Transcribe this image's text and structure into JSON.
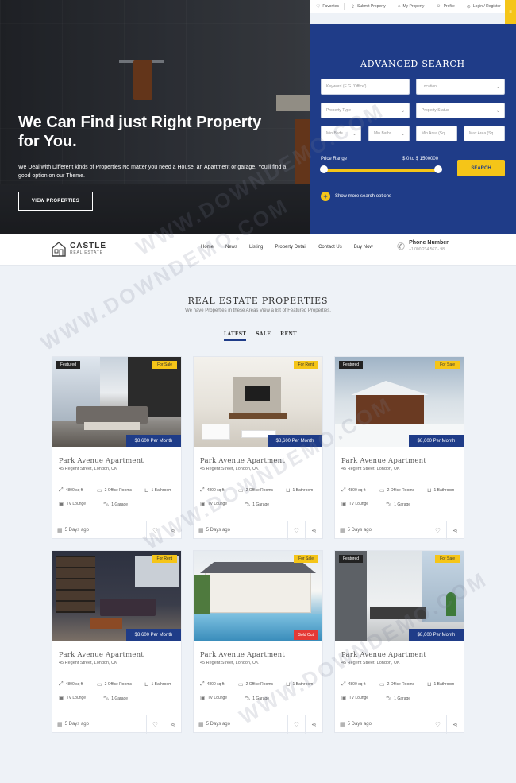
{
  "hero": {
    "title": "We Can Find just Right Property for You.",
    "subtitle": "We Deal with Different kinds of Properties No matter you need a House, an Apartment or garage. You'll find a good option on our Theme.",
    "button": "VIEW PROPERTIES"
  },
  "topbar": {
    "items": [
      "Favorites",
      "Submit Property",
      "My Property",
      "Profile",
      "Login / Register"
    ]
  },
  "search": {
    "title": "ADVANCED SEARCH",
    "keyword_placeholder": "Keyword (E.G. 'Office')",
    "location": "Location",
    "property_type": "Property Type",
    "property_status": "Property Status",
    "min_beds": "Min Beds",
    "min_baths": "Min Baths",
    "min_area": "Min Area (Sq",
    "max_area": "Max Area (Sq",
    "price_label": "Price Range",
    "price_value": "$ 0 to $ 1500000",
    "button": "SEARCH",
    "more": "Show more search options"
  },
  "nav": {
    "logo_name": "CASTLE",
    "logo_tag": "REAL ESTATE",
    "menu": [
      "Home",
      "News",
      "Listing",
      "Property Detail",
      "Contact Us",
      "Buy Now"
    ],
    "phone_title": "Phone Number",
    "phone_number": "+1 000 234 567 - 98"
  },
  "section": {
    "title": "REAL ESTATE PROPERTIES",
    "subtitle": "We have Properties in these Areas View a list of Featured Properties.",
    "tabs": [
      "LATEST",
      "SALE",
      "RENT"
    ]
  },
  "cards": [
    {
      "badge_left": "Featured",
      "badge_right": "For Sale",
      "price": "$8,600 Per Month",
      "title": "Park Avenue Apartment",
      "address": "45 Regent Street, London, UK",
      "area": "4800 sq ft",
      "rooms": "2 Office Rooms",
      "bath": "1 Bathroom",
      "tv": "TV Lounge",
      "garage": "1 Garage",
      "date": "5 Days ago"
    },
    {
      "badge_left": "",
      "badge_right": "For Rent",
      "price": "$8,600 Per Month",
      "title": "Park Avenue Apartment",
      "address": "45 Regent Street, London, UK",
      "area": "4800 sq ft",
      "rooms": "2 Office Rooms",
      "bath": "1 Bathroom",
      "tv": "TV Lounge",
      "garage": "1 Garage",
      "date": "5 Days ago"
    },
    {
      "badge_left": "Featured",
      "badge_right": "For Sale",
      "price": "$8,600 Per Month",
      "title": "Park Avenue Apartment",
      "address": "45 Regent Street, London, UK",
      "area": "4800 sq ft",
      "rooms": "2 Office Rooms",
      "bath": "1 Bathroom",
      "tv": "TV Lounge",
      "garage": "1 Garage",
      "date": "5 Days ago"
    },
    {
      "badge_left": "",
      "badge_right": "For Rent",
      "price": "$8,600 Per Month",
      "title": "Park Avenue Apartment",
      "address": "45 Regent Street, London, UK",
      "area": "4800 sq ft",
      "rooms": "2 Office Rooms",
      "bath": "1 Bathroom",
      "tv": "TV Lounge",
      "garage": "1 Garage",
      "date": "5 Days ago"
    },
    {
      "badge_left": "",
      "badge_right": "For Sale",
      "badge_sold": "Sold Out",
      "price": "",
      "title": "Park Avenue Apartment",
      "address": "45 Regent Street, London, UK",
      "area": "4800 sq ft",
      "rooms": "2 Office Rooms",
      "bath": "1 Bathroom",
      "tv": "TV Lounge",
      "garage": "1 Garage",
      "date": "5 Days ago"
    },
    {
      "badge_left": "Featured",
      "badge_right": "For Sale",
      "price": "$8,600 Per Month",
      "title": "Park Avenue Apartment",
      "address": "45 Regent Street, London, UK",
      "area": "4800 sq ft",
      "rooms": "2 Office Rooms",
      "bath": "1 Bathroom",
      "tv": "TV Lounge",
      "garage": "1 Garage",
      "date": "5 Days ago"
    }
  ],
  "watermark": "WWW.DOWNDEMO.COM",
  "colors": {
    "primary": "#1f3c88",
    "accent": "#f5c518",
    "sold": "#e53935"
  }
}
